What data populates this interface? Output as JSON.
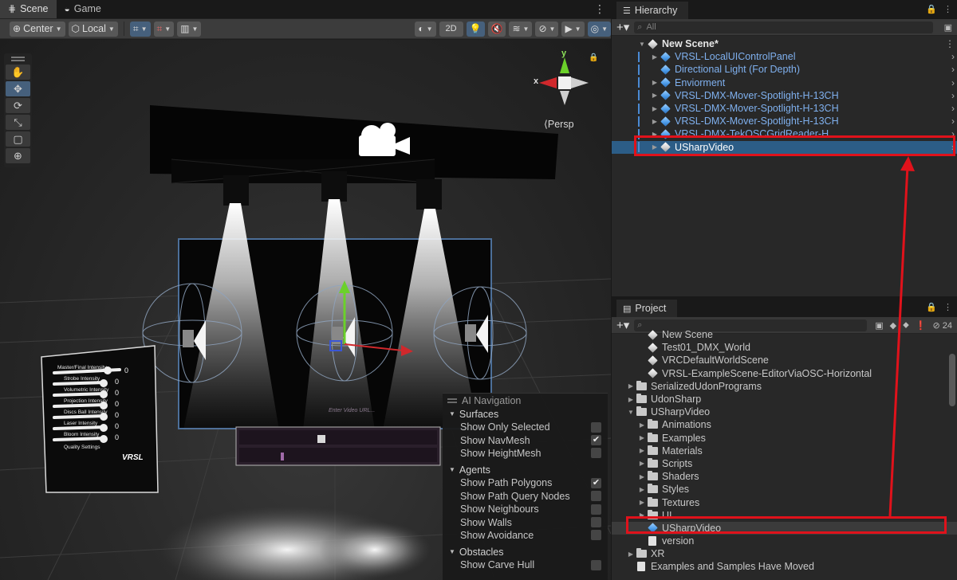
{
  "scene_window": {
    "tabs": [
      {
        "label": "Scene",
        "icon": "grid-icon"
      },
      {
        "label": "Game",
        "icon": "gamepad-icon"
      }
    ],
    "toolbar": {
      "pivot_label": "Center",
      "space_label": "Local",
      "mode_2d_label": "2D"
    },
    "persp_label": "Persp",
    "gizmo_axes": {
      "x": "x",
      "y": "y"
    },
    "ui_panel": {
      "labels": [
        "Master/Final Intensity",
        "Strobe Intensity",
        "Volumetric Intensity",
        "Projection Intensity",
        "Discs Ball Intensity",
        "Laser Intensity",
        "Bloom Intensity"
      ],
      "values": [
        "0",
        "0",
        "0",
        "0",
        "0",
        "0",
        "0"
      ],
      "quality_label": "Quality Settings",
      "logo_text": "VRSL"
    },
    "video_player": {
      "url_placeholder": "Enter Video URL..."
    }
  },
  "ai_navigation": {
    "title": "AI Navigation",
    "sections": [
      {
        "title": "Surfaces",
        "options": [
          {
            "label": "Show Only Selected",
            "checked": false
          },
          {
            "label": "Show NavMesh",
            "checked": true
          },
          {
            "label": "Show HeightMesh",
            "checked": false
          }
        ]
      },
      {
        "title": "Agents",
        "options": [
          {
            "label": "Show Path Polygons",
            "checked": true
          },
          {
            "label": "Show Path Query Nodes",
            "checked": false
          },
          {
            "label": "Show Neighbours",
            "checked": false
          },
          {
            "label": "Show Walls",
            "checked": false
          },
          {
            "label": "Show Avoidance",
            "checked": false
          }
        ]
      },
      {
        "title": "Obstacles",
        "options": [
          {
            "label": "Show Carve Hull",
            "checked": false
          }
        ]
      }
    ]
  },
  "hierarchy": {
    "tab_label": "Hierarchy",
    "search_placeholder": "All",
    "scene_name": "New Scene*",
    "items": [
      {
        "label": "VRSL-LocalUIControlPanel",
        "expandable": true,
        "prefab": true
      },
      {
        "label": "Directional Light (For Depth)",
        "expandable": false,
        "prefab": true
      },
      {
        "label": "Enviorment",
        "expandable": true,
        "prefab": true
      },
      {
        "label": "VRSL-DMX-Mover-Spotlight-H-13CH",
        "expandable": true,
        "prefab": true
      },
      {
        "label": "VRSL-DMX-Mover-Spotlight-H-13CH",
        "expandable": true,
        "prefab": true
      },
      {
        "label": "VRSL-DMX-Mover-Spotlight-H-13CH",
        "expandable": true,
        "prefab": true
      },
      {
        "label": "VRSL-DMX-TekOSCGridReader-H",
        "expandable": true,
        "prefab": true
      },
      {
        "label": "USharpVideo",
        "expandable": true,
        "prefab": false,
        "selected": true
      }
    ]
  },
  "project": {
    "tab_label": "Project",
    "hidden_count": "24",
    "items": [
      {
        "label": "New Scene",
        "depth": 2,
        "type": "scene"
      },
      {
        "label": "Test01_DMX_World",
        "depth": 2,
        "type": "scene"
      },
      {
        "label": "VRCDefaultWorldScene",
        "depth": 2,
        "type": "scene"
      },
      {
        "label": "VRSL-ExampleScene-EditorViaOSC-Horizontal",
        "depth": 2,
        "type": "scene"
      },
      {
        "label": "SerializedUdonPrograms",
        "depth": 1,
        "type": "folder",
        "state": "collapsed"
      },
      {
        "label": "UdonSharp",
        "depth": 1,
        "type": "folder",
        "state": "collapsed"
      },
      {
        "label": "USharpVideo",
        "depth": 1,
        "type": "folder",
        "state": "expanded"
      },
      {
        "label": "Animations",
        "depth": 2,
        "type": "folder",
        "state": "collapsed"
      },
      {
        "label": "Examples",
        "depth": 2,
        "type": "folder",
        "state": "collapsed"
      },
      {
        "label": "Materials",
        "depth": 2,
        "type": "folder",
        "state": "collapsed"
      },
      {
        "label": "Scripts",
        "depth": 2,
        "type": "folder",
        "state": "collapsed"
      },
      {
        "label": "Shaders",
        "depth": 2,
        "type": "folder",
        "state": "collapsed"
      },
      {
        "label": "Styles",
        "depth": 2,
        "type": "folder",
        "state": "collapsed"
      },
      {
        "label": "Textures",
        "depth": 2,
        "type": "folder",
        "state": "collapsed"
      },
      {
        "label": "UI",
        "depth": 2,
        "type": "folder",
        "state": "collapsed"
      },
      {
        "label": "USharpVideo",
        "depth": 2,
        "type": "prefab",
        "highlight": true
      },
      {
        "label": "version",
        "depth": 2,
        "type": "file"
      },
      {
        "label": "XR",
        "depth": 1,
        "type": "folder",
        "state": "collapsed"
      },
      {
        "label": "Examples and Samples Have Moved",
        "depth": 1,
        "type": "file"
      }
    ]
  },
  "colors": {
    "annotation_red": "#e0121b",
    "selection_blue": "#2c5d87",
    "prefab_text": "#7fb0ee"
  }
}
